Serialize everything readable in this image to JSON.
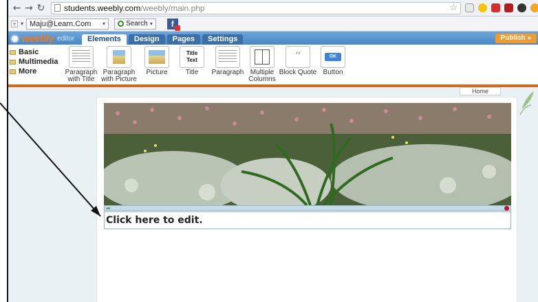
{
  "browser": {
    "url_host": "students.weebly.com",
    "url_path": "/weebly/main.php",
    "profile_combo": "Maju@Learn.Com",
    "search_label": "Search"
  },
  "editor": {
    "logo_text": "weebly",
    "logo_sub": "editor",
    "tabs": [
      {
        "label": "Elements"
      },
      {
        "label": "Design"
      },
      {
        "label": "Pages"
      },
      {
        "label": "Settings"
      }
    ],
    "publish_label": "Publish »"
  },
  "categories": [
    {
      "label": "Basic"
    },
    {
      "label": "Multimedia"
    },
    {
      "label": "More"
    }
  ],
  "elements": [
    {
      "label1": "Paragraph",
      "label2": "with Title"
    },
    {
      "label1": "Paragraph",
      "label2": "with Picture"
    },
    {
      "label1": "Picture",
      "label2": ""
    },
    {
      "label1": "Title",
      "label2": ""
    },
    {
      "label1": "Paragraph",
      "label2": ""
    },
    {
      "label1": "Multiple",
      "label2": "Columns"
    },
    {
      "label1": "Block Quote",
      "label2": ""
    },
    {
      "label1": "Button",
      "label2": ""
    }
  ],
  "thumb_texts": {
    "title_text": "Title Text",
    "ok": "OK"
  },
  "site": {
    "nav_home": "Home",
    "edit_prompt": "Click here to edit."
  }
}
